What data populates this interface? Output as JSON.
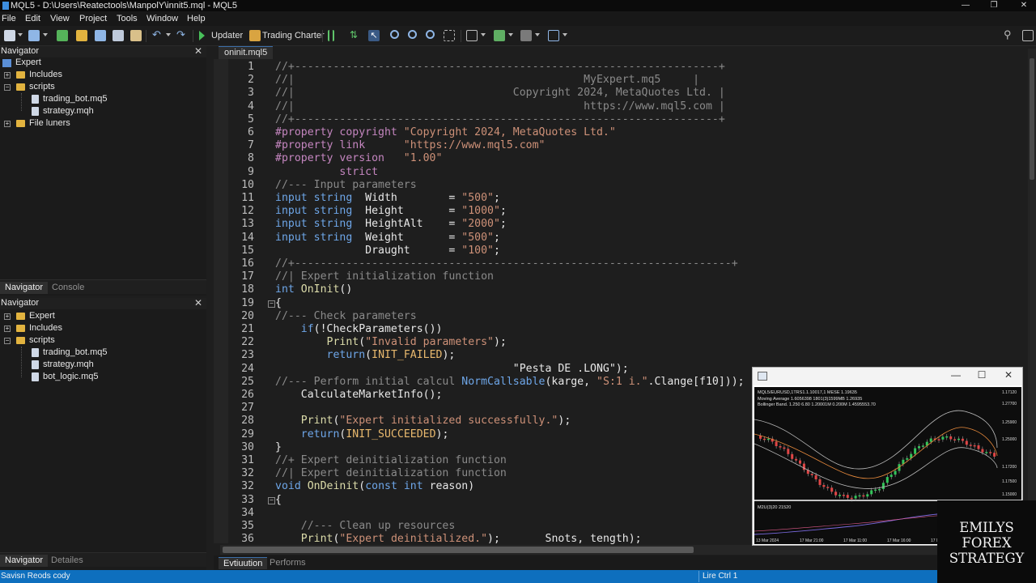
{
  "window": {
    "title": "MQL5 - D:\\Users\\Reatectools\\ManpolY\\innit5.mql - MQL5",
    "minimize": "—",
    "maximize": "❐",
    "close": "✕"
  },
  "menu": [
    "File",
    "Edit",
    "View",
    "Project",
    "Tools",
    "Window",
    "Help"
  ],
  "toolbar": {
    "updater_label": "Updater",
    "trading_charter_label": "Trading Charter"
  },
  "navigator_top": {
    "title": "Navigator",
    "close": "✕",
    "items": [
      {
        "label": "Expert"
      },
      {
        "label": "Includes"
      },
      {
        "label": "scripts"
      },
      {
        "label": "trading_bot.mq5"
      },
      {
        "label": "strategy.mqh"
      },
      {
        "label": "File luners"
      }
    ],
    "tabs": [
      "Navigator",
      "Console"
    ]
  },
  "navigator_bottom": {
    "title": "Navigator",
    "close": "✕",
    "items": [
      {
        "label": "Expert"
      },
      {
        "label": "Includes"
      },
      {
        "label": "scripts"
      },
      {
        "label": "trading_bot.mq5"
      },
      {
        "label": "strategy.mqh"
      },
      {
        "label": "bot_logic.mq5"
      }
    ],
    "tabs": [
      "Navigator",
      "Detailes"
    ]
  },
  "editor": {
    "file_tab": "oninit.mql5",
    "lines": [
      {
        "n": "1",
        "tokens": [
          [
            "c-com",
            "//+------------------------------------------------------------------+"
          ]
        ]
      },
      {
        "n": "2",
        "tokens": [
          [
            "c-com",
            "//|                                             MyExpert.mq5     |"
          ]
        ]
      },
      {
        "n": "3",
        "tokens": [
          [
            "c-com",
            "//|                                  Copyright 2024, MetaQuotes Ltd. |"
          ]
        ]
      },
      {
        "n": "4",
        "tokens": [
          [
            "c-com",
            "//|                                             https://www.mql5.com |"
          ]
        ]
      },
      {
        "n": "5",
        "tokens": [
          [
            "c-com",
            "//+------------------------------------------------------------------+"
          ]
        ]
      },
      {
        "n": "6",
        "tokens": [
          [
            "c-pp",
            "#property copyright "
          ],
          [
            "c-str",
            "\"Copyright 2024, MetaQuotes Ltd.\""
          ]
        ]
      },
      {
        "n": "7",
        "tokens": [
          [
            "c-pp",
            "#property link      "
          ],
          [
            "c-str",
            "\"https://www.mql5.com\""
          ]
        ]
      },
      {
        "n": "8",
        "tokens": [
          [
            "c-pp",
            "#property version   "
          ],
          [
            "c-str",
            "\"1.00\""
          ]
        ]
      },
      {
        "n": "9",
        "tokens": [
          [
            "c-pp",
            "          strict"
          ]
        ]
      },
      {
        "n": "10",
        "tokens": [
          [
            "c-com",
            "//--- Input parameters"
          ]
        ]
      },
      {
        "n": "11",
        "tokens": [
          [
            "c-kw",
            "input string  "
          ],
          [
            "c-id",
            "Width        = "
          ],
          [
            "c-str",
            "\"500\""
          ],
          [
            "c-id",
            ";"
          ]
        ]
      },
      {
        "n": "12",
        "tokens": [
          [
            "c-kw",
            "input string  "
          ],
          [
            "c-id",
            "Height       = "
          ],
          [
            "c-str",
            "\"1000\""
          ],
          [
            "c-id",
            ";"
          ]
        ]
      },
      {
        "n": "13",
        "tokens": [
          [
            "c-kw",
            "input string  "
          ],
          [
            "c-id",
            "HeightAlt    = "
          ],
          [
            "c-str",
            "\"2000\""
          ],
          [
            "c-id",
            ";"
          ]
        ]
      },
      {
        "n": "14",
        "tokens": [
          [
            "c-kw",
            "input string  "
          ],
          [
            "c-id",
            "Weight       = "
          ],
          [
            "c-str",
            "\"500\""
          ],
          [
            "c-id",
            ";"
          ]
        ]
      },
      {
        "n": "15",
        "tokens": [
          [
            "c-id",
            "              Draught      = "
          ],
          [
            "c-str",
            "\"100\""
          ],
          [
            "c-id",
            ";"
          ]
        ]
      },
      {
        "n": "16",
        "tokens": [
          [
            "c-com",
            "//+--------------------------------------------------------------------+"
          ]
        ]
      },
      {
        "n": "17",
        "tokens": [
          [
            "c-com",
            "//| Expert initialization function"
          ]
        ]
      },
      {
        "n": "18",
        "tokens": [
          [
            "c-kw",
            "int "
          ],
          [
            "c-fn",
            "OnInit"
          ],
          [
            "c-id",
            "()"
          ]
        ]
      },
      {
        "n": "19",
        "fold": "−",
        "tokens": [
          [
            "c-id",
            "{"
          ]
        ]
      },
      {
        "n": "20",
        "tokens": [
          [
            "c-com",
            "//--- Check parameters"
          ]
        ]
      },
      {
        "n": "21",
        "tokens": [
          [
            "c-id",
            "    "
          ],
          [
            "c-kw",
            "if"
          ],
          [
            "c-id",
            "(!CheckParameters())"
          ]
        ]
      },
      {
        "n": "22",
        "tokens": [
          [
            "c-id",
            "        "
          ],
          [
            "c-fn",
            "Print"
          ],
          [
            "c-id",
            "("
          ],
          [
            "c-str",
            "\"Invalid parameters\""
          ],
          [
            "c-id",
            ");"
          ]
        ]
      },
      {
        "n": "23",
        "tokens": [
          [
            "c-id",
            "        "
          ],
          [
            "c-kw",
            "return"
          ],
          [
            "c-id",
            "("
          ],
          [
            "c-const",
            "INIT_FAILED"
          ],
          [
            "c-id",
            ");"
          ]
        ]
      },
      {
        "n": "24",
        "tokens": [
          [
            "c-id",
            "                                     \"Pesta DE .LONG\");"
          ]
        ]
      },
      {
        "n": "25",
        "tokens": [
          [
            "c-com",
            "//--- Perform initial calcul "
          ],
          [
            "c-kw",
            "NormCallsable"
          ],
          [
            "c-id",
            "(karge, "
          ],
          [
            "c-str",
            "\"S:1 i.\""
          ],
          [
            "c-id",
            ".Clange[f10]));"
          ]
        ]
      },
      {
        "n": "26",
        "tokens": [
          [
            "c-id",
            "    CalculateMarketInfo();"
          ]
        ]
      },
      {
        "n": "27",
        "tokens": []
      },
      {
        "n": "28",
        "tokens": [
          [
            "c-id",
            "    "
          ],
          [
            "c-fn",
            "Print"
          ],
          [
            "c-id",
            "("
          ],
          [
            "c-str",
            "\"Expert initialized successfully.\""
          ],
          [
            "c-id",
            ");"
          ]
        ]
      },
      {
        "n": "29",
        "tokens": [
          [
            "c-id",
            "    "
          ],
          [
            "c-kw",
            "return"
          ],
          [
            "c-id",
            "("
          ],
          [
            "c-const",
            "INIT_SUCCEEDED"
          ],
          [
            "c-id",
            ");"
          ]
        ]
      },
      {
        "n": "30",
        "tokens": [
          [
            "c-id",
            "}"
          ]
        ]
      },
      {
        "n": "31",
        "tokens": [
          [
            "c-com",
            "//+ Expert deinitialization function"
          ]
        ]
      },
      {
        "n": "32",
        "tokens": [
          [
            "c-com",
            "//| Expert deinitialization function"
          ]
        ]
      },
      {
        "n": "32",
        "tokens": [
          [
            "c-kw",
            "void "
          ],
          [
            "c-fn",
            "OnDeinit"
          ],
          [
            "c-id",
            "("
          ],
          [
            "c-kw",
            "const int "
          ],
          [
            "c-id",
            "reason)"
          ]
        ]
      },
      {
        "n": "33",
        "fold": "−",
        "tokens": [
          [
            "c-id",
            "{"
          ]
        ]
      },
      {
        "n": "34",
        "tokens": []
      },
      {
        "n": "35",
        "tokens": [
          [
            "c-id",
            "    "
          ],
          [
            "c-com",
            "//--- Clean up resources"
          ]
        ]
      },
      {
        "n": "36",
        "tokens": [
          [
            "c-id",
            "    "
          ],
          [
            "c-fn",
            "Print"
          ],
          [
            "c-id",
            "("
          ],
          [
            "c-str",
            "\"Expert deinitialized.\""
          ],
          [
            "c-id",
            ");       Snots, tength);"
          ]
        ]
      }
    ]
  },
  "editor_tabs": [
    "Evtiuution",
    "Performs"
  ],
  "status": {
    "left": "Savisn Reods cody",
    "right": "Lire Ctrl 1"
  },
  "chart_window": {
    "header_text": "MQL5/EURUSD,1ТRS1.1.10017,1 MESE 1.19635",
    "indicator_lines": [
      "Moving Average 1.6056398 1801(3)1599MB 1.26935",
      "Bollinger Band. 1.250 6.80 1.20001M 0.200M 1.4595553.70"
    ],
    "price_labels": [
      "1.17120",
      "1.27700",
      "1.25900",
      "1.25000",
      "1.17200",
      "1.17500",
      "1.15000"
    ],
    "sub_label": "M2U(3)20 21520",
    "time_labels": [
      "13 Mar 2024",
      "17 Mar 21:00",
      "17 Mar 11:00",
      "17 Mar 16:00",
      "17 Mar 21:00",
      "17 Mar"
    ],
    "accent_up": "#33c55a",
    "accent_down": "#e04545"
  },
  "watermark": {
    "line1": "EMILYS",
    "line2": "FOREX",
    "line3": "STRATEGY"
  }
}
